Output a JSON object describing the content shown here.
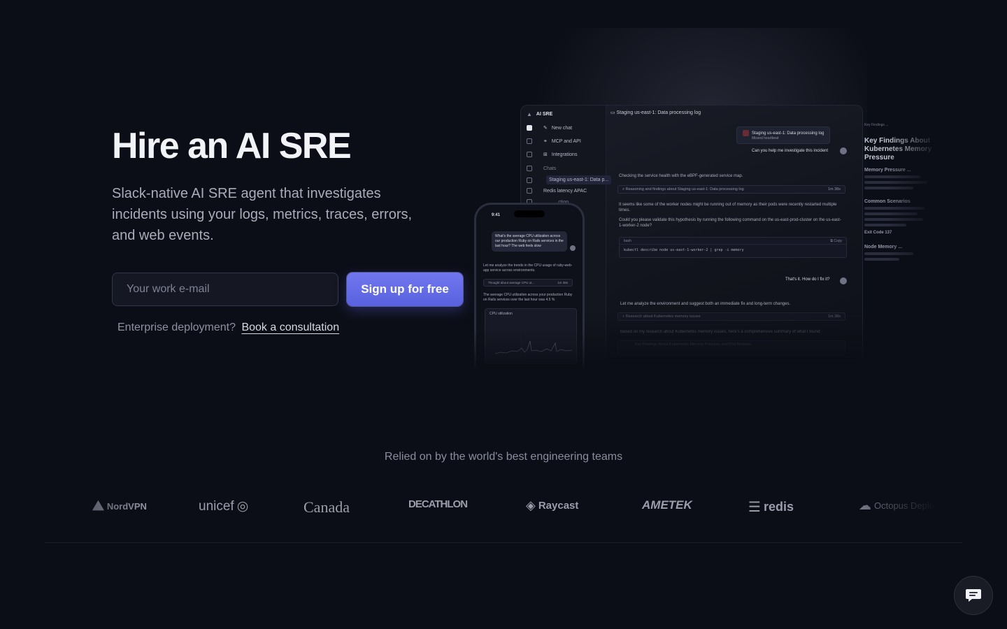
{
  "hero": {
    "title": "Hire an AI SRE",
    "subtitle": "Slack-native AI SRE agent that investigates incidents using your logs, metrics, traces, errors, and web events.",
    "email_placeholder": "Your work e-mail",
    "signup_label": "Sign up for free",
    "enterprise_text": "Enterprise deployment?",
    "consult_link": "Book a consultation"
  },
  "mock": {
    "app_name": "AI SRE",
    "sidebar": [
      "New chat",
      "MCP and API",
      "Integrations"
    ],
    "chats_heading": "Chats",
    "chats": [
      "Staging us-east-1: Data p...",
      "Redis latency APAC",
      "... ... ...ction"
    ],
    "chat_title": "Staging us-east-1: Data processing log",
    "incident_card_title": "Staging us-east-1: Data processing log",
    "incident_card_sub": "Missed heartbeat",
    "user_q1": "Can you help me investigate this incident",
    "a1": "Checking the service health with the eBPF-generated service map.",
    "reasoning": "Reasoning and findings about Staging us-east-1: Data processing log",
    "reasoning_time": "1m 38s",
    "a2": "It seems like some of the worker nodes might be running out of memory as their pods were recently restarted multiple times.",
    "a3": "Could you please validate this hypothesis by running the following command on the us-east-prod-cluster on the us-east-1-worker-2 node?",
    "code_lang": "bash",
    "copy_label": "Copy",
    "code": "kubectl describe node us-east-1-worker-2 | grep -i memory",
    "user_q2": "That's it. How do I fix it?",
    "a4": "Let me analyze the environment and suggest both an immediate fix and long-term changes.",
    "research": "Research about Kubernetes memory issues",
    "research_time": "1m 38s",
    "a5": "Based on my research about Kubernetes memory issues, here's a comprehensive summary of what I found:",
    "finding_card": "Key Findings About Kubernetes Memory Pressure and Pod Restarts",
    "right_heading": "Key Findings About Kubernetes Memory Pressure",
    "right_tab": "Key Findings ...",
    "right_s1": "Memory Pressure ...",
    "right_s2": "Common Scenarios",
    "right_s3": "Node Memory ...",
    "right_bullet": "Exit Code 137"
  },
  "phone": {
    "time": "9:41",
    "question": "What's the average CPU utilization across our production Ruby on Rails services in the last hour? The web feels slow",
    "p1": "Let me analyze the trends in the CPU usage of ruby-web-app service across environments.",
    "thought": "Thought about average CPU ut...",
    "thought_time": "1m 38s",
    "p2": "The average CPU utilization across your production Ruby on Rails services over the last hour was 4.5 %",
    "chart_title": "CPU utilization"
  },
  "relied": "Relied on by the world's best engineering teams",
  "logos": [
    "NordVPN",
    "unicef",
    "Canada",
    "DECATHLON",
    "Raycast",
    "AMETEK",
    "redis",
    "Octopus Deploy"
  ],
  "colors": {
    "bg": "#0c0e17",
    "accent": "#6168e6"
  }
}
